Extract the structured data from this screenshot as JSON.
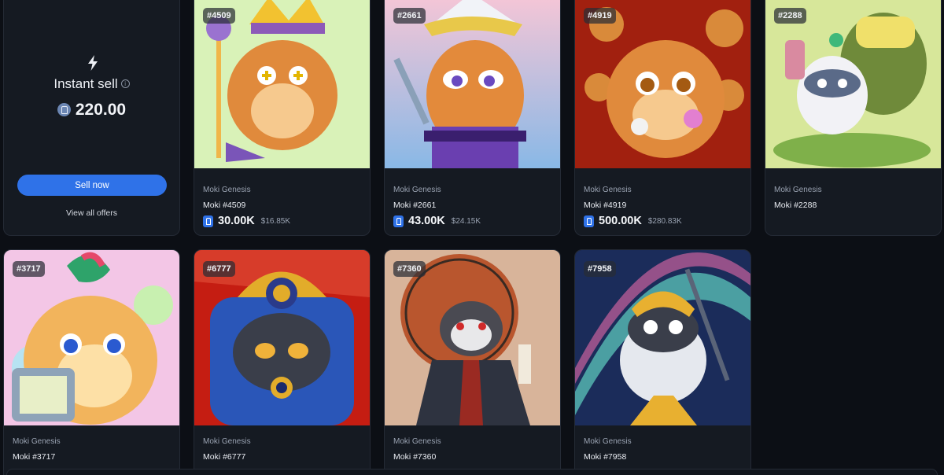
{
  "instant_sell": {
    "title": "Instant sell",
    "info_glyph": "i",
    "amount": "220.00",
    "button_label": "Sell now",
    "view_offers_label": "View all offers"
  },
  "cards": [
    {
      "tag": "#4509",
      "collection": "Moki Genesis",
      "name": "Moki #4509",
      "price": "30.00K",
      "usd": "$16.85K",
      "bg": "#d9f2b8"
    },
    {
      "tag": "#2661",
      "collection": "Moki Genesis",
      "name": "Moki #2661",
      "price": "43.00K",
      "usd": "$24.15K",
      "bg": "#f6b3c8"
    },
    {
      "tag": "#4919",
      "collection": "Moki Genesis",
      "name": "Moki #4919",
      "price": "500.00K",
      "usd": "$280.83K",
      "bg": "#a1200f"
    },
    {
      "tag": "#2288",
      "collection": "Moki Genesis",
      "name": "Moki #2288",
      "bg": "#d7e79a"
    },
    {
      "tag": "#3717",
      "collection": "Moki Genesis",
      "name": "Moki #3717",
      "bg": "#f3c6e6"
    },
    {
      "tag": "#6777",
      "collection": "Moki Genesis",
      "name": "Moki #6777",
      "bg": "#c51d12"
    },
    {
      "tag": "#7360",
      "collection": "Moki Genesis",
      "name": "Moki #7360",
      "bg": "#d8b49a"
    },
    {
      "tag": "#7958",
      "collection": "Moki Genesis",
      "name": "Moki #7958",
      "bg": "#1b2c5a"
    }
  ],
  "icons": {
    "bolt": "lightning-bolt-icon",
    "ron": "ronin-coin-icon",
    "price_badge": "ronin-token-icon"
  }
}
